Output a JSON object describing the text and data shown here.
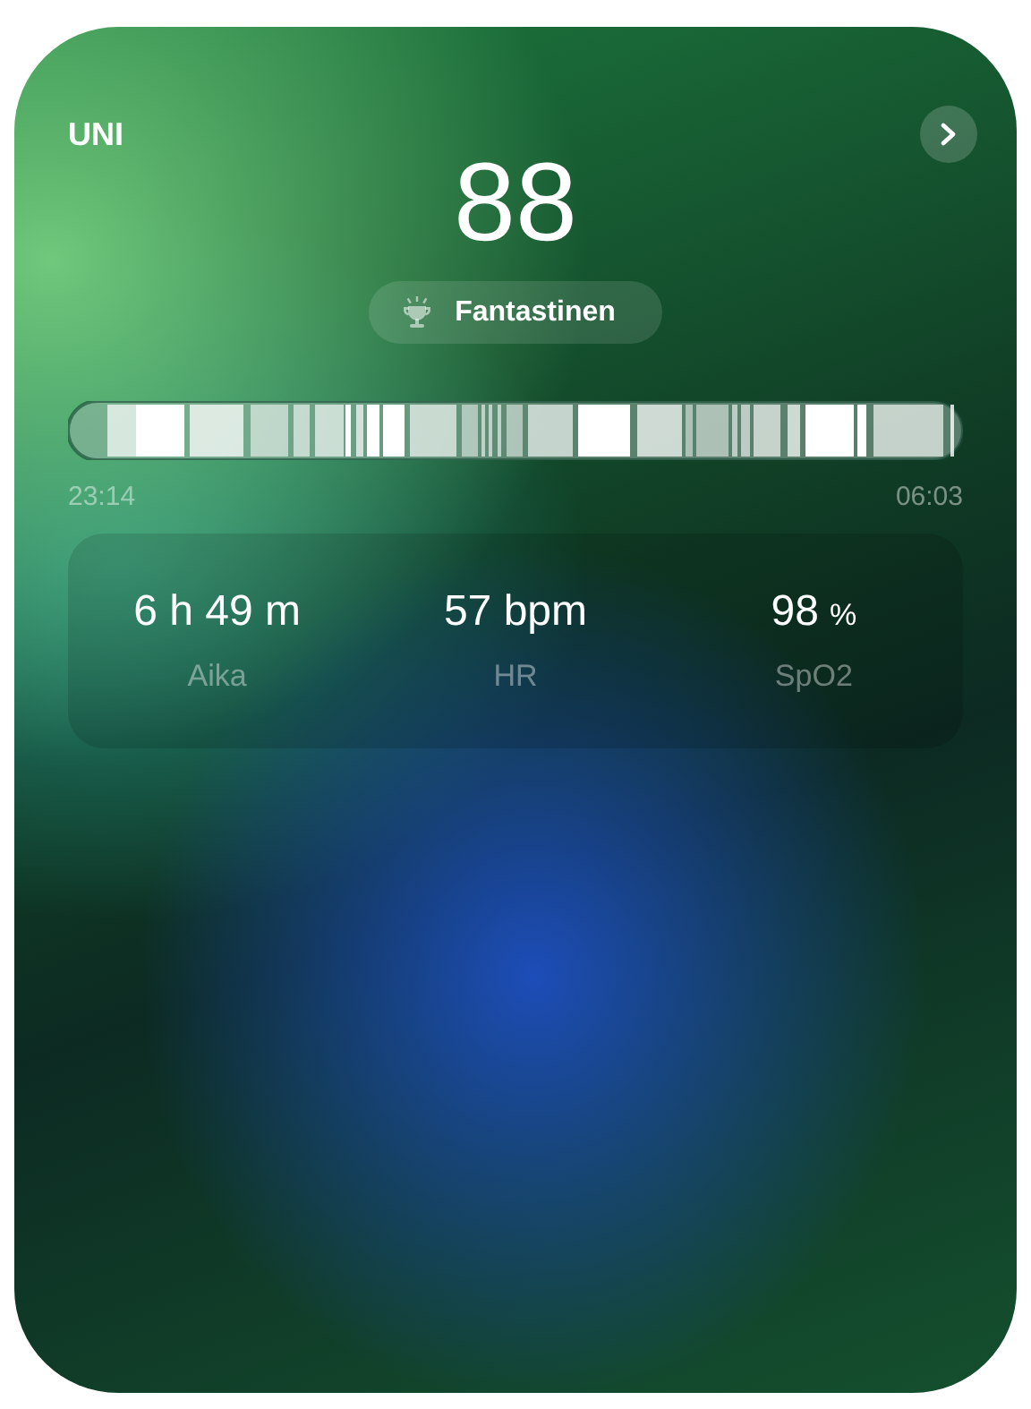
{
  "title": "UNI",
  "score": "88",
  "rating": "Fantastinen",
  "start_time": "23:14",
  "end_time": "06:03",
  "stats": [
    {
      "value": "6 h 49 m",
      "label": "Aika"
    },
    {
      "value": "57 bpm",
      "label": "HR"
    },
    {
      "value": "98",
      "unit": "%",
      "label": "SpO2"
    }
  ]
}
